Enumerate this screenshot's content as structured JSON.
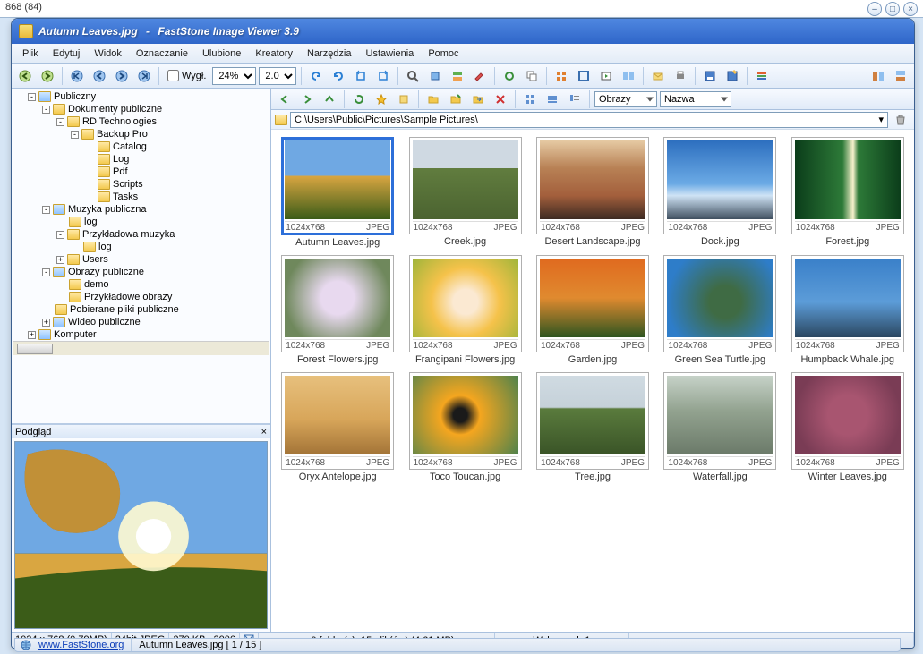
{
  "top_text": "868 (84)",
  "title": {
    "file": "Autumn Leaves.jpg",
    "app": "FastStone Image Viewer 3.9"
  },
  "menu": [
    "Plik",
    "Edytuj",
    "Widok",
    "Oznaczanie",
    "Ulubione",
    "Kreatory",
    "Narzędzia",
    "Ustawienia",
    "Pomoc"
  ],
  "toolbar": {
    "view_checkbox_label": "Wygł.",
    "zoom": "24%",
    "zoom_alt": "2.0"
  },
  "tree": [
    {
      "label": "Publiczny",
      "depth": 0,
      "exp": "-",
      "icon": "sp"
    },
    {
      "label": "Dokumenty publiczne",
      "depth": 1,
      "exp": "-",
      "icon": "fld"
    },
    {
      "label": "RD Technologies",
      "depth": 2,
      "exp": "-",
      "icon": "fld"
    },
    {
      "label": "Backup Pro",
      "depth": 3,
      "exp": "-",
      "icon": "fld"
    },
    {
      "label": "Catalog",
      "depth": 4,
      "exp": "",
      "icon": "fld"
    },
    {
      "label": "Log",
      "depth": 4,
      "exp": "",
      "icon": "fld"
    },
    {
      "label": "Pdf",
      "depth": 4,
      "exp": "",
      "icon": "fld"
    },
    {
      "label": "Scripts",
      "depth": 4,
      "exp": "",
      "icon": "fld"
    },
    {
      "label": "Tasks",
      "depth": 4,
      "exp": "",
      "icon": "fld"
    },
    {
      "label": "Muzyka publiczna",
      "depth": 1,
      "exp": "-",
      "icon": "sp"
    },
    {
      "label": "log",
      "depth": 2,
      "exp": "",
      "icon": "fld"
    },
    {
      "label": "Przykładowa muzyka",
      "depth": 2,
      "exp": "-",
      "icon": "fld"
    },
    {
      "label": "log",
      "depth": 3,
      "exp": "",
      "icon": "fld"
    },
    {
      "label": "Users",
      "depth": 2,
      "exp": "+",
      "icon": "fld"
    },
    {
      "label": "Obrazy publiczne",
      "depth": 1,
      "exp": "-",
      "icon": "sp"
    },
    {
      "label": "demo",
      "depth": 2,
      "exp": "",
      "icon": "fld"
    },
    {
      "label": "Przykładowe obrazy",
      "depth": 2,
      "exp": "",
      "icon": "fld"
    },
    {
      "label": "Pobierane pliki publiczne",
      "depth": 1,
      "exp": "",
      "icon": "fld"
    },
    {
      "label": "Wideo publiczne",
      "depth": 1,
      "exp": "+",
      "icon": "sp"
    },
    {
      "label": "Komputer",
      "depth": 0,
      "exp": "+",
      "icon": "sp"
    }
  ],
  "preview_label": "Podgląd",
  "rtoolbar": {
    "combo1": "Obrazy",
    "combo2": "Nazwa"
  },
  "path": "C:\\Users\\Public\\Pictures\\Sample Pictures\\",
  "thumbnails": [
    {
      "name": "Autumn Leaves.jpg",
      "dim": "1024x768",
      "fmt": "JPEG",
      "selected": true,
      "grad": "linear-gradient(to bottom,#6fa8e3 0,#6fa8e3 45%,#d9a641 45%,#3b5c18 100%)"
    },
    {
      "name": "Creek.jpg",
      "dim": "1024x768",
      "fmt": "JPEG",
      "selected": false,
      "grad": "linear-gradient(to bottom,#cfd9e2 0,#cfd9e2 35%,#617d3f 35%,#4b6330 100%)"
    },
    {
      "name": "Desert Landscape.jpg",
      "dim": "1024x768",
      "fmt": "JPEG",
      "selected": false,
      "grad": "linear-gradient(to bottom,#e6caa3 0,#b88155 35%,#a35f3c 70%,#3d2a22 100%)"
    },
    {
      "name": "Dock.jpg",
      "dim": "1024x768",
      "fmt": "JPEG",
      "selected": false,
      "grad": "linear-gradient(to bottom,#2d6fbf 0,#6baae5 55%,#cfe3f5 70%,#405060 100%)"
    },
    {
      "name": "Forest.jpg",
      "dim": "1024x768",
      "fmt": "JPEG",
      "selected": false,
      "grad": "linear-gradient(to right,#0b3d1a 0,#2d7a38 45%,#f7f1cc 55%,#2d7a38 60%,#0b3d1a 100%)"
    },
    {
      "name": "Forest Flowers.jpg",
      "dim": "1024x768",
      "fmt": "JPEG",
      "selected": false,
      "grad": "radial-gradient(circle,#e8d9ef 25%,#6f885c 80%)"
    },
    {
      "name": "Frangipani Flowers.jpg",
      "dim": "1024x768",
      "fmt": "JPEG",
      "selected": false,
      "grad": "radial-gradient(circle at 50% 55%,#fbe9d2 18%,#f5c24a 50%,#9fb53a 100%)"
    },
    {
      "name": "Garden.jpg",
      "dim": "1024x768",
      "fmt": "JPEG",
      "selected": false,
      "grad": "linear-gradient(to bottom,#e06a1f 0,#e08a2f 50%,#2f5520 100%)"
    },
    {
      "name": "Green Sea Turtle.jpg",
      "dim": "1024x768",
      "fmt": "JPEG",
      "selected": false,
      "grad": "radial-gradient(circle at 55% 55%,#3f6b44 22%,#2e7dc9 80%)"
    },
    {
      "name": "Humpback Whale.jpg",
      "dim": "1024x768",
      "fmt": "JPEG",
      "selected": false,
      "grad": "linear-gradient(to bottom,#3a80c9 0,#5c9cd8 55%,#2b4760 100%)"
    },
    {
      "name": "Oryx Antelope.jpg",
      "dim": "1024x768",
      "fmt": "JPEG",
      "selected": false,
      "grad": "linear-gradient(to bottom,#e7c07d 0,#d8a65a 55%,#a37437 100%)"
    },
    {
      "name": "Toco Toucan.jpg",
      "dim": "1024x768",
      "fmt": "JPEG",
      "selected": false,
      "grad": "radial-gradient(circle at 45% 50%,#1a1a1a 10%,#f5a61f 28%,#4e824c 100%)"
    },
    {
      "name": "Tree.jpg",
      "dim": "1024x768",
      "fmt": "JPEG",
      "selected": false,
      "grad": "linear-gradient(to bottom,#d0dbe2 0,#c5d1d9 40%,#5a7b3d 42%,#3a5427 100%)"
    },
    {
      "name": "Waterfall.jpg",
      "dim": "1024x768",
      "fmt": "JPEG",
      "selected": false,
      "grad": "linear-gradient(to bottom,#c6d2c8 0,#92a28f 45%,#6b7a69 100%)"
    },
    {
      "name": "Winter Leaves.jpg",
      "dim": "1024x768",
      "fmt": "JPEG",
      "selected": false,
      "grad": "radial-gradient(circle,#a85570 30%,#7a3c55 80%)"
    }
  ],
  "status": {
    "left": {
      "dim": "1024 x 768 (0.79MP)",
      "depth": "24bit JPEG",
      "size": "270 KB",
      "year": "2006"
    },
    "center": "0 folder(y), 15 plik(ów) (4.61 MB)",
    "right": "Wybranych 1",
    "url": "www.FastStone.org",
    "current": "Autumn Leaves.jpg [ 1 / 15 ]"
  }
}
